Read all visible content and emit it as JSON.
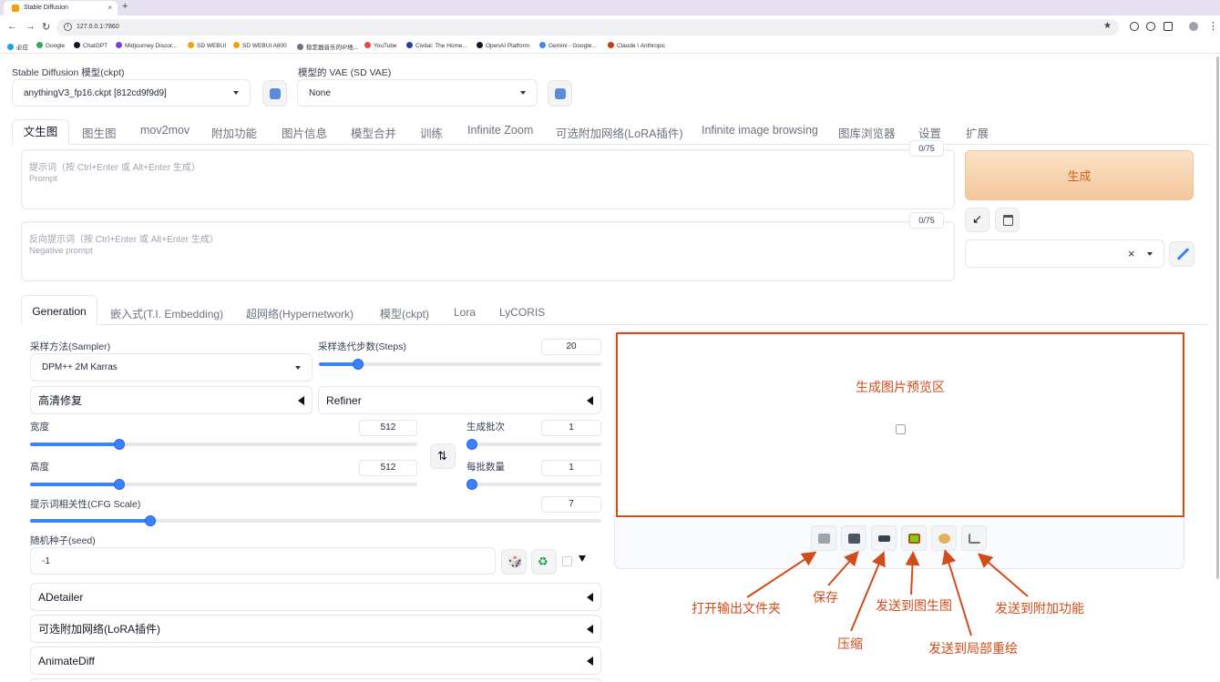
{
  "browser": {
    "tab_title": "Stable Diffusion",
    "new_tab": "+",
    "url": "127.0.0.1:7860",
    "bookmarks": [
      {
        "label": "必应",
        "color": "#0ea5e9"
      },
      {
        "label": "Google",
        "color": "#34a853"
      },
      {
        "label": "ChatGPT",
        "color": "#111827"
      },
      {
        "label": "Midjourney Discor...",
        "color": "#7c3aed"
      },
      {
        "label": "SD WEBUI",
        "color": "#f59e0b"
      },
      {
        "label": "SD WEBUI A800",
        "color": "#f59e0b"
      },
      {
        "label": "稳定器音乐的IP地...",
        "color": "#6b7280"
      },
      {
        "label": "YouTube",
        "color": "#ef4444"
      },
      {
        "label": "Civitai: The Home...",
        "color": "#1e40af"
      },
      {
        "label": "OpenAI Platform",
        "color": "#111827"
      },
      {
        "label": "Gemini - Google...",
        "color": "#4285f4"
      },
      {
        "label": "Claude \\ Anthropic",
        "color": "#c2410c"
      }
    ]
  },
  "top": {
    "ckpt_label": "Stable Diffusion 模型(ckpt)",
    "ckpt_value": "anythingV3_fp16.ckpt [812cd9f9d9]",
    "vae_label": "模型的 VAE (SD VAE)",
    "vae_value": "None"
  },
  "main_tabs": [
    "文生图",
    "图生图",
    "mov2mov",
    "附加功能",
    "图片信息",
    "模型合并",
    "训练",
    "Infinite Zoom",
    "可选附加网络(LoRA插件)",
    "Infinite image browsing",
    "图库浏览器",
    "设置",
    "扩展"
  ],
  "prompt": {
    "placeholder_zh": "提示词（按 Ctrl+Enter 或 Alt+Enter 生成）",
    "placeholder_en": "Prompt",
    "counter": "0/75"
  },
  "negative": {
    "placeholder_zh": "反向提示词（按 Ctrl+Enter 或 Alt+Enter 生成）",
    "placeholder_en": "Negative prompt",
    "counter": "0/75"
  },
  "generate_label": "生成",
  "style_clear": "×",
  "sub_tabs": [
    "Generation",
    "嵌入式(T.I. Embedding)",
    "超网络(Hypernetwork)",
    "模型(ckpt)",
    "Lora",
    "LyCORIS"
  ],
  "params": {
    "sampler_label": "采样方法(Sampler)",
    "sampler_value": "DPM++ 2M Karras",
    "steps_label": "采样迭代步数(Steps)",
    "steps_value": "20",
    "hires_label": "高清修复",
    "refiner_label": "Refiner",
    "width_label": "宽度",
    "width_value": "512",
    "height_label": "高度",
    "height_value": "512",
    "batch_count_label": "生成批次",
    "batch_count_value": "1",
    "batch_size_label": "每批数量",
    "batch_size_value": "1",
    "cfg_label": "提示词相关性(CFG Scale)",
    "cfg_value": "7",
    "seed_label": "随机种子(seed)",
    "seed_value": "-1",
    "sliders": {
      "steps": 0.14,
      "width": 0.23,
      "height": 0.23,
      "batch_count": 0.0,
      "batch_size": 0.0,
      "cfg": 0.21
    }
  },
  "accordions": [
    "ADetailer",
    "可选附加网络(LoRA插件)",
    "AnimateDiff"
  ],
  "output": {
    "preview_label": "生成图片预览区",
    "accent": "#d14b1b"
  },
  "annotations": {
    "open_folder": "打开输出文件夹",
    "save": "保存",
    "zip": "压缩",
    "send_img2img": "发送到图生图",
    "send_inpaint": "发送到局部重绘",
    "send_extras": "发送到附加功能"
  },
  "icons": {
    "folder": "folder-icon",
    "save": "save-icon",
    "zip": "zip-icon",
    "img2img": "image-icon",
    "inpaint": "palette-icon",
    "extras": "ruler-icon"
  }
}
